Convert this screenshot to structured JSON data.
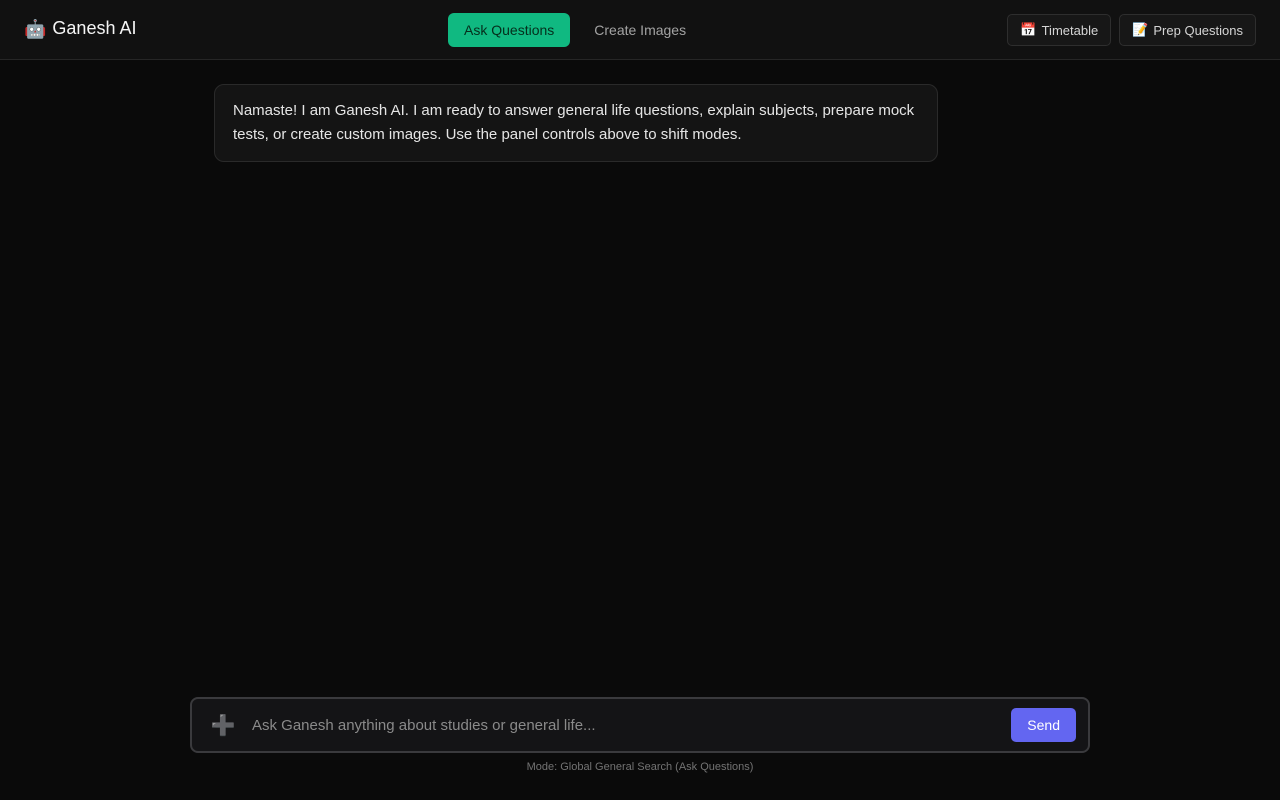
{
  "header": {
    "logo_icon": "🤖",
    "title": "Ganesh AI",
    "tabs": [
      {
        "label": "Ask Questions",
        "active": true
      },
      {
        "label": "Create Images",
        "active": false
      }
    ],
    "actions": [
      {
        "icon": "📅",
        "label": "Timetable"
      },
      {
        "icon": "📝",
        "label": "Prep Questions"
      }
    ]
  },
  "chat": {
    "messages": [
      {
        "role": "assistant",
        "text": "Namaste! I am Ganesh AI. I am ready to answer general life questions, explain subjects, prepare mock tests, or create custom images. Use the panel controls above to shift modes."
      }
    ]
  },
  "composer": {
    "attach_icon": "➕",
    "placeholder": "Ask Ganesh anything about studies or general life...",
    "value": "",
    "send_label": "Send"
  },
  "status": {
    "mode_text": "Mode: Global General Search (Ask Questions)"
  },
  "colors": {
    "accent_green": "#10b981",
    "send_purple": "#6366f1",
    "background": "#0a0a0a"
  }
}
